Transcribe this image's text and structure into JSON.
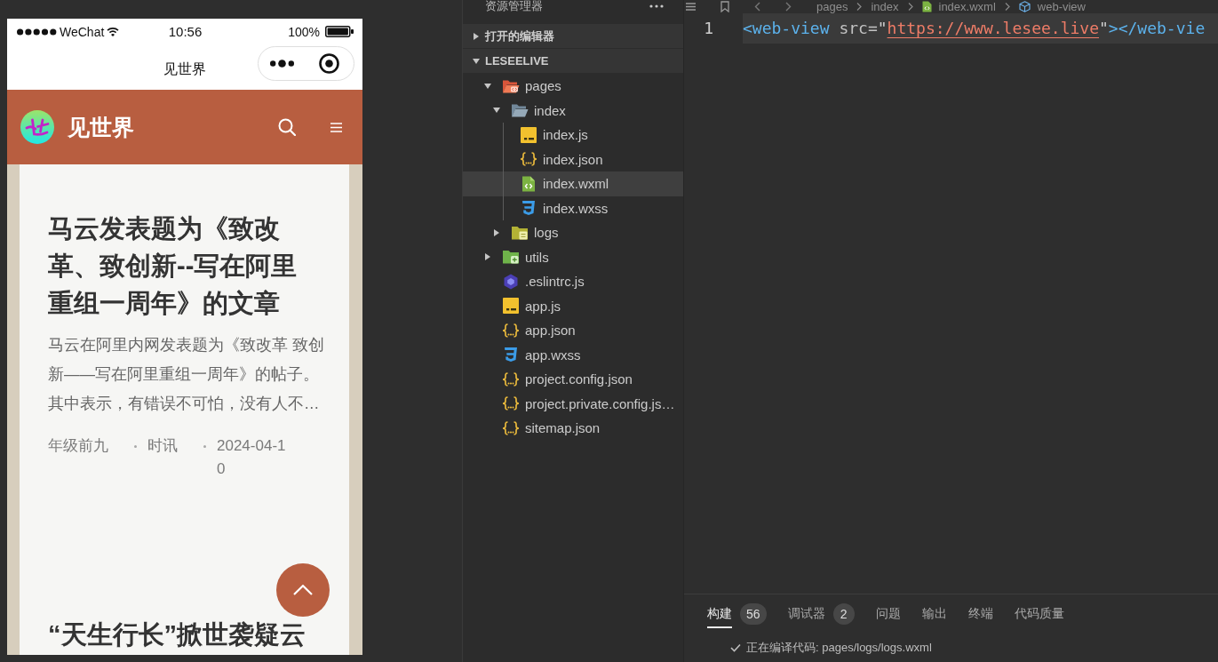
{
  "simulator": {
    "status_bar": {
      "carrier": "WeChat",
      "time": "10:56",
      "battery": "100%"
    },
    "nav_bar": {
      "title": "见世界"
    },
    "app_header": {
      "title": "见世界"
    },
    "articles": [
      {
        "title": "马云发表题为《致改革、致创新--写在阿里重组一周年》的文章",
        "summary": "马云在阿里内网发表题为《致改革 致创新——写在阿里重组一周年》的帖子。其中表示，有错误不可怕，没有人不…",
        "author": "年级前九",
        "category": "时讯",
        "date": "2024-04-10"
      },
      {
        "title": "“天生行长”掀世袭疑云"
      }
    ]
  },
  "explorer": {
    "title": "资源管理器",
    "sections": [
      {
        "label": "打开的编辑器",
        "expanded": false
      },
      {
        "label": "LESEELIVE",
        "expanded": true,
        "tree": [
          {
            "label": "pages",
            "kind": "pagesfolder",
            "expanded": true,
            "selected": false,
            "children": [
              {
                "label": "index",
                "kind": "folder",
                "expanded": true,
                "selected": false,
                "children": [
                  {
                    "label": "index.js",
                    "kind": "js",
                    "selected": false
                  },
                  {
                    "label": "index.json",
                    "kind": "json",
                    "selected": false
                  },
                  {
                    "label": "index.wxml",
                    "kind": "wxml",
                    "selected": true
                  },
                  {
                    "label": "index.wxss",
                    "kind": "wxss",
                    "selected": false
                  }
                ]
              },
              {
                "label": "logs",
                "kind": "logsfolder",
                "expanded": false,
                "selected": false
              }
            ]
          },
          {
            "label": "utils",
            "kind": "utilsfolder",
            "expanded": false,
            "selected": false
          },
          {
            "label": ".eslintrc.js",
            "kind": "eslint",
            "selected": false
          },
          {
            "label": "app.js",
            "kind": "js",
            "selected": false
          },
          {
            "label": "app.json",
            "kind": "json",
            "selected": false
          },
          {
            "label": "app.wxss",
            "kind": "wxss",
            "selected": false
          },
          {
            "label": "project.config.json",
            "kind": "json",
            "selected": false
          },
          {
            "label": "project.private.config.js…",
            "kind": "json",
            "selected": false
          },
          {
            "label": "sitemap.json",
            "kind": "json",
            "selected": false
          }
        ]
      }
    ]
  },
  "editor": {
    "breadcrumb": [
      {
        "label": "pages",
        "kind": "folder"
      },
      {
        "label": "index",
        "kind": "folder"
      },
      {
        "label": "index.wxml",
        "kind": "file"
      },
      {
        "label": "web-view",
        "kind": "element"
      }
    ],
    "lines": [
      {
        "number": "1",
        "current": true,
        "tokens": [
          {
            "text": "<web-view",
            "kind": "tag"
          },
          {
            "text": " src=",
            "kind": "attr"
          },
          {
            "text": "\"",
            "kind": "punct"
          },
          {
            "text": "https://www.lesee.live",
            "kind": "link"
          },
          {
            "text": "\"",
            "kind": "punct"
          },
          {
            "text": ">",
            "kind": "tag"
          },
          {
            "text": "</web-vie",
            "kind": "tag"
          }
        ]
      }
    ]
  },
  "panel": {
    "tabs": [
      {
        "label": "构建",
        "badge": "56",
        "selected": true
      },
      {
        "label": "调试器",
        "badge": "2",
        "selected": false
      },
      {
        "label": "问题",
        "selected": false
      },
      {
        "label": "输出",
        "selected": false
      },
      {
        "label": "终端",
        "selected": false
      },
      {
        "label": "代码质量",
        "selected": false
      }
    ],
    "output": [
      {
        "text": "正在编译代码: pages/logs/logs.wxml"
      }
    ]
  }
}
